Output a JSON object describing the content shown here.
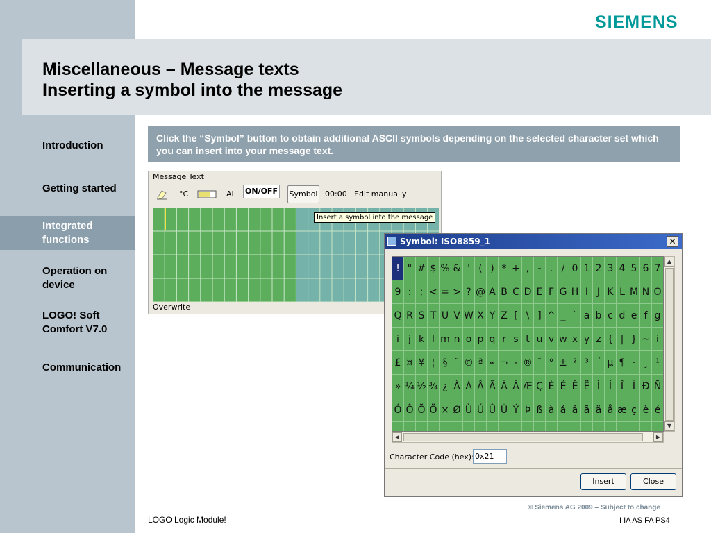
{
  "brand": {
    "logo_text": "SIEMENS",
    "logo_color": "#009999"
  },
  "header": {
    "title_line1": "Miscellaneous – Message texts",
    "title_line2": "Inserting a symbol into the message"
  },
  "sidebar": {
    "active_index": 2,
    "items": [
      {
        "label": "Introduction"
      },
      {
        "label": "Getting started"
      },
      {
        "label": "Integrated functions"
      },
      {
        "label": "Operation on device"
      },
      {
        "label": "LOGO! Soft Comfort V7.0"
      },
      {
        "label": "Communication"
      }
    ]
  },
  "info_box": {
    "text": "Click the “Symbol” button to obtain additional ASCII symbols depending on the selected character set which you can insert into your message text."
  },
  "message_text_panel": {
    "legend": "Message Text",
    "toolbar": {
      "eraser_icon": "eraser-icon",
      "temp_label": "°C",
      "bar_icon": "analog-bar-icon",
      "ai_label": "AI",
      "onoff_label": "ON/OFF",
      "symbol_button": "Symbol",
      "time_label": "00:00",
      "edit_label": "Edit manually"
    },
    "status": "Overwrite",
    "tooltip": "Insert a symbol into the message"
  },
  "symbol_dialog": {
    "title": "Symbol: ISO8859_1",
    "close_glyph": "✕",
    "selected_char": "!",
    "char_rows": [
      [
        "!",
        "\"",
        "#",
        "$",
        "%",
        "&",
        "'",
        "(",
        ")",
        "*",
        "+",
        ",",
        "-",
        ".",
        "/",
        "0",
        "1",
        "2",
        "3",
        "4",
        "5",
        "6",
        "7"
      ],
      [
        "9",
        ":",
        ";",
        "<",
        "=",
        ">",
        "?",
        "@",
        "A",
        "B",
        "C",
        "D",
        "E",
        "F",
        "G",
        "H",
        "I",
        "J",
        "K",
        "L",
        "M",
        "N",
        "O"
      ],
      [
        "Q",
        "R",
        "S",
        "T",
        "U",
        "V",
        "W",
        "X",
        "Y",
        "Z",
        "[",
        "\\",
        "]",
        "^",
        "_",
        "`",
        "a",
        "b",
        "c",
        "d",
        "e",
        "f",
        "g"
      ],
      [
        "i",
        "j",
        "k",
        "l",
        "m",
        "n",
        "o",
        "p",
        "q",
        "r",
        "s",
        "t",
        "u",
        "v",
        "w",
        "x",
        "y",
        "z",
        "{",
        "|",
        "}",
        "~",
        "i"
      ],
      [
        "£",
        "¤",
        "¥",
        "¦",
        "§",
        "¨",
        "©",
        "ª",
        "«",
        "¬",
        "-",
        "®",
        "¯",
        "°",
        "±",
        "²",
        "³",
        "´",
        "µ",
        "¶",
        "·",
        "¸",
        "¹"
      ],
      [
        "»",
        "¼",
        "½",
        "¾",
        "¿",
        "À",
        "Á",
        "Â",
        "Ã",
        "Ä",
        "Å",
        "Æ",
        "Ç",
        "È",
        "É",
        "Ê",
        "Ë",
        "Ì",
        "Í",
        "Î",
        "Ï",
        "Ð",
        "Ñ"
      ],
      [
        "Ó",
        "Ô",
        "Õ",
        "Ö",
        "×",
        "Ø",
        "Ù",
        "Ú",
        "Û",
        "Ü",
        "Ý",
        "Þ",
        "ß",
        "à",
        "á",
        "â",
        "ã",
        "ä",
        "å",
        "æ",
        "ç",
        "è",
        "é"
      ]
    ],
    "code_label": "Character Code (hex):",
    "code_value": "0x21",
    "insert_button": "Insert",
    "close_button": "Close"
  },
  "footer": {
    "left_text": "LOGO Logic Module!",
    "copyright": "© Siemens AG 2009 – Subject to change",
    "code": "I IA AS FA PS4"
  }
}
